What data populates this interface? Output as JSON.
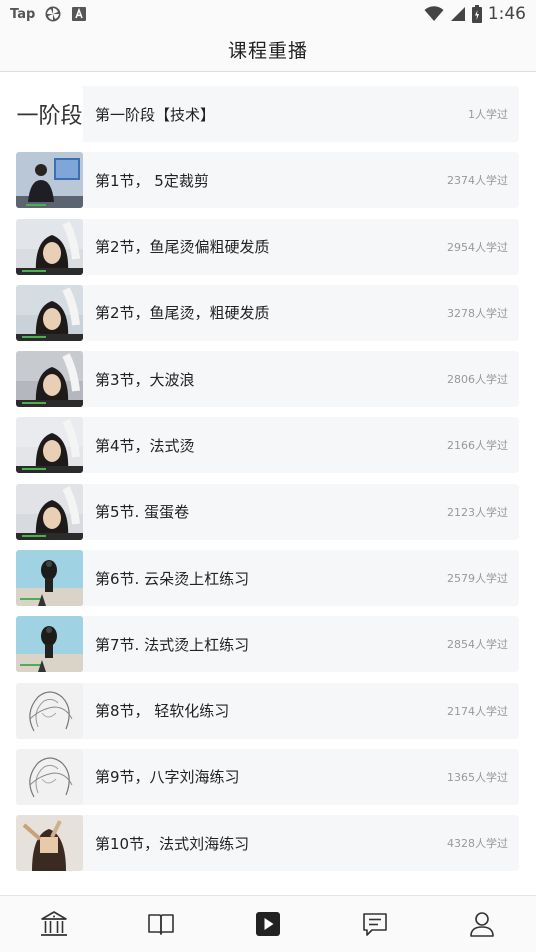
{
  "status_bar": {
    "app_badge": "Tap",
    "time": "1:46",
    "icons": [
      "tap-badge",
      "pinwheel-icon",
      "font-app-icon",
      "wifi-icon",
      "cell-signal-icon",
      "battery-icon"
    ]
  },
  "header": {
    "title": "课程重播"
  },
  "courses": [
    {
      "title": "第一阶段【技术】",
      "learners": "1人学过",
      "thumb_text": "一阶段",
      "thumb": "stage-banner"
    },
    {
      "title": "第1节， 5定裁剪",
      "learners": "2374人学过",
      "thumb": "presenter-studio"
    },
    {
      "title": "第2节，鱼尾烫偏粗硬发质",
      "learners": "2954人学过",
      "thumb": "salon-closeup"
    },
    {
      "title": "第2节，鱼尾烫，粗硬发质",
      "learners": "3278人学过",
      "thumb": "salon-styling"
    },
    {
      "title": "第3节，大波浪",
      "learners": "2806人学过",
      "thumb": "salon-waves"
    },
    {
      "title": "第4节，法式烫",
      "learners": "2166人学过",
      "thumb": "salon-perm"
    },
    {
      "title": "第5节. 蛋蛋卷",
      "learners": "2123人学过",
      "thumb": "salon-curl"
    },
    {
      "title": "第6节. 云朵烫上杠练习",
      "learners": "2579人学过",
      "thumb": "mannequin-rods"
    },
    {
      "title": "第7节. 法式烫上杠练习",
      "learners": "2854人学过",
      "thumb": "mannequin-rods"
    },
    {
      "title": "第8节， 轻软化练习",
      "learners": "2174人学过",
      "thumb": "sketch-hair"
    },
    {
      "title": "第9节，八字刘海练习",
      "learners": "1365人学过",
      "thumb": "sketch-hair"
    },
    {
      "title": "第10节，法式刘海练习",
      "learners": "4328人学过",
      "thumb": "bangs-cutting"
    }
  ],
  "tab_bar": {
    "tabs": [
      {
        "icon": "institution-icon",
        "active": false
      },
      {
        "icon": "open-book-icon",
        "active": false
      },
      {
        "icon": "play-square-icon",
        "active": true
      },
      {
        "icon": "message-icon",
        "active": false
      },
      {
        "icon": "person-icon",
        "active": false
      }
    ]
  }
}
